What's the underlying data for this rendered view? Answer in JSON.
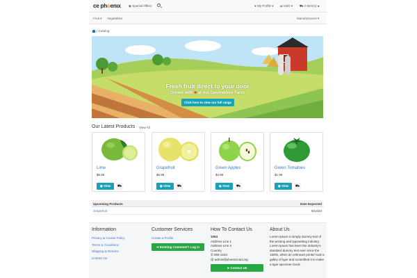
{
  "header": {
    "logo_prefix": "ce ph",
    "logo_accent": "o",
    "logo_suffix": "enıx",
    "special_offers": "Special Offers",
    "my_profile": "My Profile",
    "currency": "USD",
    "cart": "0 item(s)"
  },
  "nav": {
    "fruit": "Fruit",
    "vegetables": "Vegetables",
    "manufacturers": "Manufacturers"
  },
  "breadcrumb": {
    "separator": "/",
    "current": "Catalog"
  },
  "banner": {
    "title": "Fresh fruit direct to your door",
    "subtitle_before": "Grown with",
    "subtitle_after": "at our Devonshire Farm",
    "button": "Click here to view our full range"
  },
  "latest": {
    "heading": "Our Latest Products",
    "view_all": "View All",
    "view_label": "View",
    "products": [
      {
        "name": "Lime",
        "price": "$6.65"
      },
      {
        "name": "Grapefruit",
        "price": "$6.99"
      },
      {
        "name": "Green Apples",
        "price": "$4.99"
      },
      {
        "name": "Green Tomatoes",
        "price": "$1.99"
      }
    ]
  },
  "upcoming": {
    "col_product": "Upcoming Products",
    "col_date": "Date Expected",
    "rows": [
      {
        "product": "Grapefruit",
        "date": "9/14/24"
      }
    ]
  },
  "footer": {
    "information": {
      "heading": "Information",
      "links": [
        "Privacy & Cookie Policy",
        "Terms & Conditions",
        "Shipping & Returns",
        "Contact Us"
      ]
    },
    "customer": {
      "heading": "Customer Services",
      "create_profile": "Create a Profile",
      "login_button": "Existing Customer? Log in"
    },
    "contact": {
      "heading": "How To Contact Us",
      "company": "1054",
      "address1": "Address Line 1",
      "address2": "Address Line 2",
      "country": "Country",
      "phone": "555-1234",
      "email": "admin@phoenixcart.org",
      "button": "Contact Us"
    },
    "about": {
      "heading": "About Us",
      "text": "Lorem Ipsum is simply dummy text of the printing and typesetting industry. Lorem Ipsum has been the industry's standard dummy text ever since the 1500s, when an unknown printer took a galley of type and scrambled it to make a type specimen book."
    }
  },
  "colors": {
    "accent": "#17a2b8",
    "link": "#3a79c9",
    "success": "#28a745"
  }
}
